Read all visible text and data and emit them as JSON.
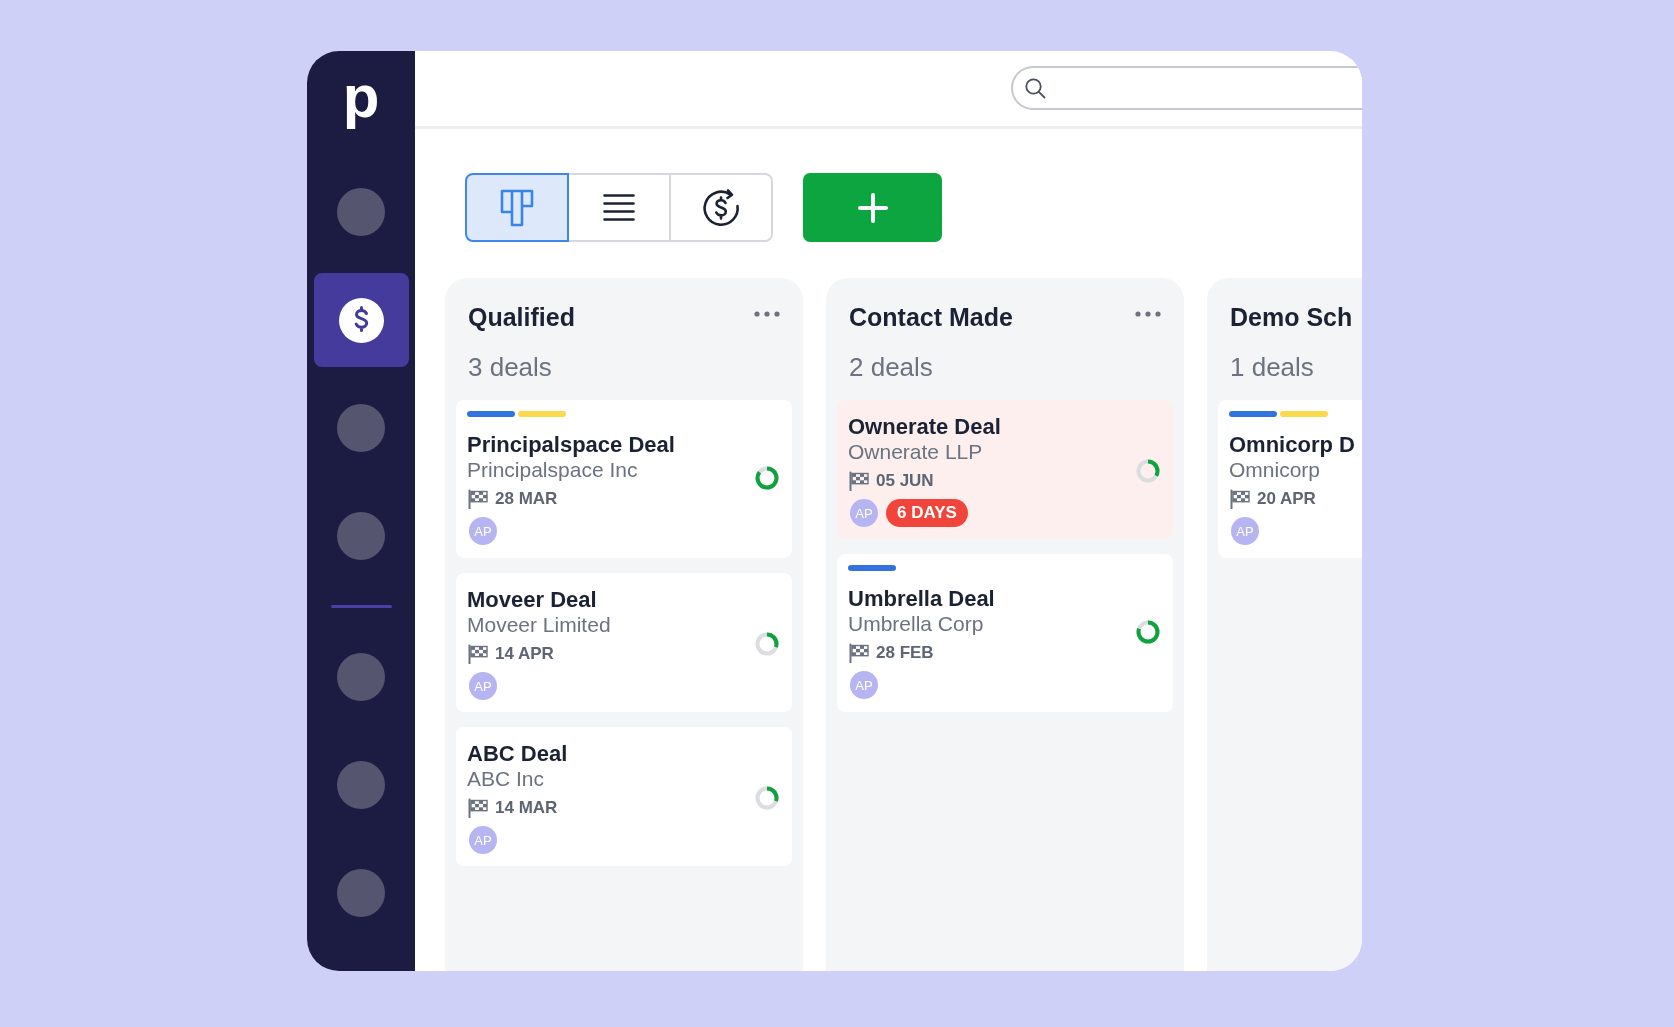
{
  "sidebar": {
    "logo": "p",
    "nav_groups": [
      {
        "items": [
          {
            "kind": "placeholder",
            "selected": false
          },
          {
            "kind": "deals",
            "selected": true
          },
          {
            "kind": "placeholder",
            "selected": false
          },
          {
            "kind": "placeholder",
            "selected": false
          }
        ]
      },
      {
        "items": [
          {
            "kind": "placeholder",
            "selected": false
          },
          {
            "kind": "placeholder",
            "selected": false
          },
          {
            "kind": "placeholder",
            "selected": false
          }
        ]
      }
    ]
  },
  "toolbar": {
    "views": [
      {
        "kind": "board",
        "selected": true
      },
      {
        "kind": "list",
        "selected": false
      },
      {
        "kind": "forecast",
        "selected": false
      }
    ]
  },
  "columns": [
    {
      "title": "Qualified",
      "count": "3 deals",
      "more_menu": true,
      "deals": [
        {
          "labels": [
            {
              "color": "#3174e0"
            },
            {
              "color": "#fbd94c"
            }
          ],
          "title": "Principalspace Deal",
          "company": "Principalspace Inc",
          "date": "28 MAR",
          "owner": "AP",
          "overdue": false,
          "level": 0.85
        },
        {
          "title": "Moveer Deal",
          "company": "Moveer Limited",
          "date": "14 APR",
          "owner": "AP",
          "overdue": false,
          "level": 0.3
        },
        {
          "title": "ABC Deal",
          "company": "ABC Inc",
          "date": "14 MAR",
          "owner": "AP",
          "overdue": false,
          "level": 0.3
        }
      ]
    },
    {
      "title": "Contact Made",
      "count": "2 deals",
      "more_menu": true,
      "deals": [
        {
          "title": "Ownerate Deal",
          "company": "Ownerate LLP",
          "date": "05 JUN",
          "owner": "AP",
          "overdue": true,
          "badge": "6 DAYS",
          "level": 0.33
        },
        {
          "labels": [
            {
              "color": "#3174e0"
            }
          ],
          "title": "Umbrella Deal",
          "company": "Umbrella Corp",
          "date": "28 FEB",
          "owner": "AP",
          "overdue": false,
          "level": 0.8
        }
      ]
    },
    {
      "title": "Demo Sch",
      "count": "1 deals",
      "more_menu": false,
      "deals": [
        {
          "labels": [
            {
              "color": "#3174e0"
            },
            {
              "color": "#fbd94c"
            }
          ],
          "title": "Omnicorp D",
          "company": "Omnicorp",
          "date": "20 APR",
          "owner": "AP",
          "overdue": false
        }
      ]
    }
  ]
}
